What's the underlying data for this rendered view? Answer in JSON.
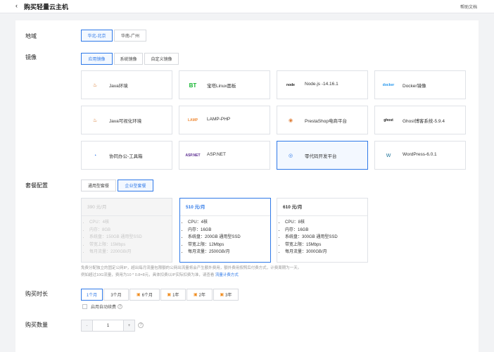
{
  "header": {
    "back_icon": "‹",
    "title": "购买轻量云主机",
    "help": "帮助文档"
  },
  "region": {
    "label": "地域",
    "options": [
      "华北-北京",
      "华南-广州"
    ]
  },
  "image": {
    "label": "镜像",
    "tabs": [
      "应用镜像",
      "系统镜像",
      "自定义镜像"
    ],
    "tiles": [
      {
        "name": "Java环境",
        "icon": "java-icon",
        "glyph": "♨",
        "color": "#d46b19"
      },
      {
        "name": "宝塔Linux面板",
        "icon": "bt-panel-icon",
        "glyph": "BT",
        "color": "#12b52f"
      },
      {
        "name": "Node.js -14.16.1",
        "icon": "nodejs-icon",
        "glyph": "node",
        "color": "#1b1b1b"
      },
      {
        "name": "Docker镜像",
        "icon": "docker-icon",
        "glyph": "docker",
        "color": "#2496ed"
      },
      {
        "name": "Java可视化环境",
        "icon": "java-visual-icon",
        "glyph": "♨",
        "color": "#d46b19"
      },
      {
        "name": "LAMP-PHP",
        "icon": "lamp-icon",
        "glyph": "LAMP",
        "color": "#ef8d3b"
      },
      {
        "name": "PrestaShop电商平台",
        "icon": "prestashop-icon",
        "glyph": "◉",
        "color": "#df7f39"
      },
      {
        "name": "Ghost博客系统-5.9.4",
        "icon": "ghost-icon",
        "glyph": "ghost",
        "color": "#222"
      },
      {
        "name": "协同办公-工具箱",
        "icon": "toolbox-icon",
        "glyph": "◔",
        "color": "#2f79e8"
      },
      {
        "name": "ASP.NET",
        "icon": "aspnet-icon",
        "glyph": "ASP.NET",
        "color": "#5c2d91"
      },
      {
        "name": "零代码开发平台",
        "icon": "lowcode-icon",
        "glyph": "◎",
        "color": "#2f79e8"
      },
      {
        "name": "WordPress-6.0.1",
        "icon": "wordpress-icon",
        "glyph": "W",
        "color": "#21759b"
      }
    ]
  },
  "plan": {
    "label": "套餐配置",
    "tabs": [
      "通用型套餐",
      "企业型套餐"
    ],
    "cards": [
      {
        "price": "390 元/月",
        "items": [
          "CPU：4核",
          "内存：8GB",
          "系统盘：150GB 通用型SSD",
          "带宽上限：15Mbps",
          "每月流量：2200GB/月"
        ]
      },
      {
        "price": "510 元/月",
        "items": [
          "CPU：4核",
          "内存：16GB",
          "系统盘：200GB 通用型SSD",
          "带宽上限：12Mbps",
          "每月流量：2500GB/月"
        ]
      },
      {
        "price": "610 元/月",
        "items": [
          "CPU：8核",
          "内存：16GB",
          "系统盘：300GB 通用型SSD",
          "带宽上限：15Mbps",
          "每月流量：3000GB/月"
        ]
      }
    ],
    "note_line1": "免费分配独立的固定公网IP，超出每月流量包限额的公网出流量将会产生额外费用，额外费用按照后付费方式，计费周期为一天。",
    "note_line2": "例如超过10G流量，费用为10 * 0.8=8元，具体扣费以IP实际扣费为准，请查看 ",
    "note_link": "流量计费方式"
  },
  "duration": {
    "label": "购买时长",
    "options": [
      "1个月",
      "3个月",
      "6个月",
      "1年",
      "2年",
      "3年"
    ],
    "gift_icon": "gift-icon",
    "auto_renew": "启用自动续费",
    "help_icon": "question-icon"
  },
  "quantity": {
    "label": "购买数量",
    "minus": "-",
    "value": "1",
    "plus": "+",
    "help_icon": "question-icon"
  },
  "colors": {
    "accent": "#2f79e8",
    "border": "#dfe2e7",
    "selected_bg": "#f3f8ff",
    "gift": "#f08c1e"
  }
}
